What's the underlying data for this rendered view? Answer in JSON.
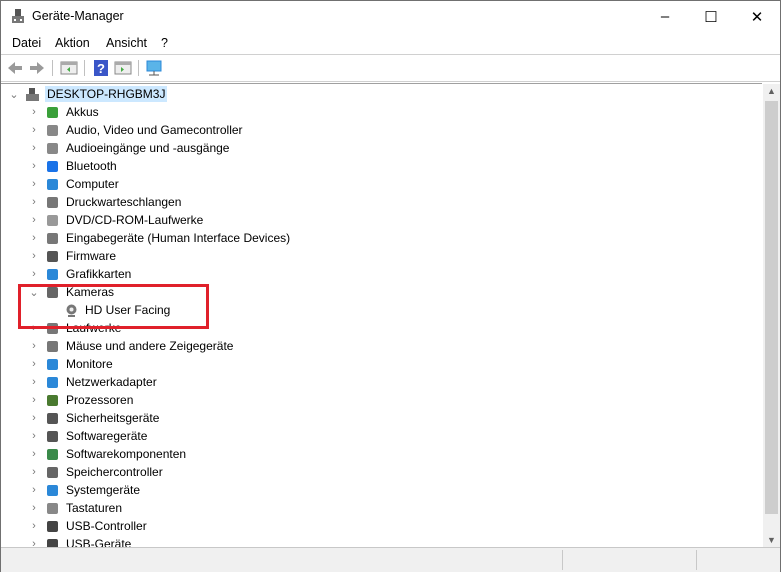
{
  "window": {
    "title": "Geräte-Manager",
    "minimize": "–",
    "maximize": "☐",
    "close": "✕"
  },
  "menu": [
    {
      "label": "Datei"
    },
    {
      "label": "Aktion"
    },
    {
      "label": "Ansicht"
    },
    {
      "label": "?"
    }
  ],
  "toolbar": [
    "back-icon",
    "forward-icon",
    "properties-icon",
    "help-icon",
    "update-driver-icon",
    "scan-hardware-icon"
  ],
  "tree": {
    "root": "DESKTOP-RHGBM3J",
    "categories": [
      {
        "label": "Akkus",
        "color": "#3aa03a"
      },
      {
        "label": "Audio, Video und Gamecontroller",
        "color": "#888888"
      },
      {
        "label": "Audioeingänge und -ausgänge",
        "color": "#888888"
      },
      {
        "label": "Bluetooth",
        "color": "#1a73e8"
      },
      {
        "label": "Computer",
        "color": "#2b88d8"
      },
      {
        "label": "Druckwarteschlangen",
        "color": "#777777"
      },
      {
        "label": "DVD/CD-ROM-Laufwerke",
        "color": "#999999"
      },
      {
        "label": "Eingabegeräte (Human Interface Devices)",
        "color": "#777777"
      },
      {
        "label": "Firmware",
        "color": "#555555"
      },
      {
        "label": "Grafikkarten",
        "color": "#2b88d8"
      },
      {
        "label": "Kameras",
        "color": "#666666",
        "expanded": true,
        "children": [
          "HD User Facing"
        ]
      },
      {
        "label": "Laufwerke",
        "color": "#777777"
      },
      {
        "label": "Mäuse und andere Zeigegeräte",
        "color": "#777777"
      },
      {
        "label": "Monitore",
        "color": "#2b88d8"
      },
      {
        "label": "Netzwerkadapter",
        "color": "#2b88d8"
      },
      {
        "label": "Prozessoren",
        "color": "#4a7a30"
      },
      {
        "label": "Sicherheitsgeräte",
        "color": "#555555"
      },
      {
        "label": "Softwaregeräte",
        "color": "#555555"
      },
      {
        "label": "Softwarekomponenten",
        "color": "#3a8a4a"
      },
      {
        "label": "Speichercontroller",
        "color": "#666666"
      },
      {
        "label": "Systemgeräte",
        "color": "#2b88d8"
      },
      {
        "label": "Tastaturen",
        "color": "#888888"
      },
      {
        "label": "USB-Controller",
        "color": "#444444"
      },
      {
        "label": "USB-Geräte",
        "color": "#444444"
      }
    ]
  },
  "highlight_color": "#e0202a"
}
